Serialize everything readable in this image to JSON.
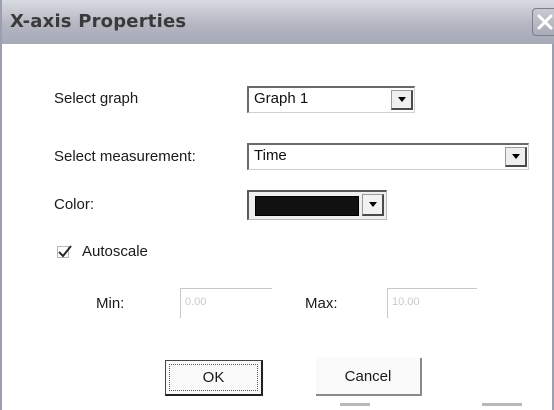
{
  "window": {
    "title": "X-axis Properties"
  },
  "form": {
    "select_graph": {
      "label": "Select graph",
      "value": "Graph 1"
    },
    "select_measurement": {
      "label": "Select measurement:",
      "value": "Time"
    },
    "color": {
      "label": "Color:",
      "value": "#111111"
    },
    "autoscale": {
      "label": "Autoscale",
      "checked": true
    },
    "min": {
      "label": "Min:",
      "value": "0.00"
    },
    "max": {
      "label": "Max:",
      "value": "10.00"
    }
  },
  "buttons": {
    "ok": "OK",
    "cancel": "Cancel"
  },
  "icons": {
    "close": "close-icon",
    "dropdown": "chevron-down-icon",
    "check": "checkmark-icon"
  }
}
